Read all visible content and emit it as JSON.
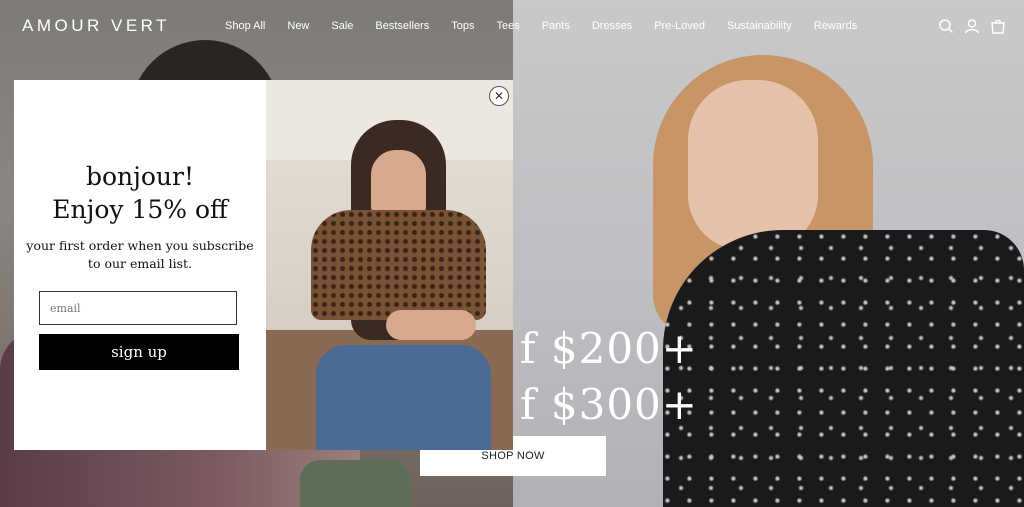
{
  "header": {
    "logo": "AMOUR VERT",
    "nav": [
      "Shop All",
      "New",
      "Sale",
      "Bestsellers",
      "Tops",
      "Tees",
      "Pants",
      "Dresses",
      "Pre-Loved",
      "Sustainability",
      "Rewards"
    ],
    "icons": [
      "search-icon",
      "account-icon",
      "bag-icon"
    ]
  },
  "hero": {
    "line1": "f $200+",
    "line2": "f $300+",
    "cta": "SHOP NOW"
  },
  "modal": {
    "headline_line1": "bonjour!",
    "headline_line2": "Enjoy 15% off",
    "subtext": "your first order when you subscribe to our email list.",
    "email_placeholder": "email",
    "signup_label": "sign up",
    "close_icon": "close-icon"
  }
}
